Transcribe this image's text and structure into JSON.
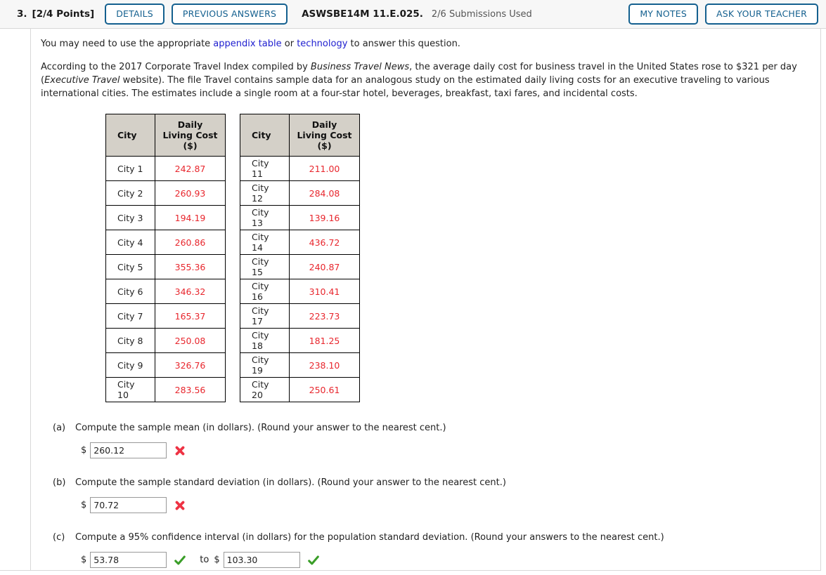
{
  "header": {
    "question_number": "3.",
    "points": "[2/4 Points]",
    "details_label": "DETAILS",
    "previous_answers_label": "PREVIOUS ANSWERS",
    "assignment_code": "ASWSBE14M 11.E.025.",
    "submissions": "2/6 Submissions Used",
    "my_notes_label": "MY NOTES",
    "ask_teacher_label": "ASK YOUR TEACHER",
    "accent_color": "#14608f",
    "bar_color": "#f7f7f7"
  },
  "intro": {
    "prefix": "You may need to use the appropriate ",
    "link1": "appendix table",
    "middle": " or ",
    "link2": "technology",
    "suffix": " to answer this question.",
    "link_color": "#2020d0"
  },
  "problem": {
    "s1": "According to the 2017 Corporate Travel Index compiled by ",
    "em1": "Business Travel News",
    "s2": ", the average daily cost for business travel in the United States rose to $321 per day (",
    "em2": "Executive Travel",
    "s3": " website). The file Travel contains sample data for an analogous study on the estimated daily living costs for an executive traveling to various international cities. The estimates include a single room at a four-star hotel, beverages, breakfast, taxi fares, and incidental costs."
  },
  "table": {
    "header_city": "City",
    "header_cost": "Daily Living Cost ($)",
    "header_bg": "#d4d0c8",
    "value_color": "#e8262d",
    "left_rows": [
      {
        "city": "City 1",
        "cost": "242.87"
      },
      {
        "city": "City 2",
        "cost": "260.93"
      },
      {
        "city": "City 3",
        "cost": "194.19"
      },
      {
        "city": "City 4",
        "cost": "260.86"
      },
      {
        "city": "City 5",
        "cost": "355.36"
      },
      {
        "city": "City 6",
        "cost": "346.32"
      },
      {
        "city": "City 7",
        "cost": "165.37"
      },
      {
        "city": "City 8",
        "cost": "250.08"
      },
      {
        "city": "City 9",
        "cost": "326.76"
      },
      {
        "city": "City 10",
        "cost": "283.56"
      }
    ],
    "right_rows": [
      {
        "city": "City 11",
        "cost": "211.00"
      },
      {
        "city": "City 12",
        "cost": "284.08"
      },
      {
        "city": "City 13",
        "cost": "139.16"
      },
      {
        "city": "City 14",
        "cost": "436.72"
      },
      {
        "city": "City 15",
        "cost": "240.87"
      },
      {
        "city": "City 16",
        "cost": "310.41"
      },
      {
        "city": "City 17",
        "cost": "223.73"
      },
      {
        "city": "City 18",
        "cost": "181.25"
      },
      {
        "city": "City 19",
        "cost": "238.10"
      },
      {
        "city": "City 20",
        "cost": "250.61"
      }
    ]
  },
  "parts": {
    "a": {
      "label": "(a)",
      "prompt": "Compute the sample mean (in dollars). (Round your answer to the nearest cent.)",
      "dollar": "$",
      "value": "260.12",
      "status": "incorrect"
    },
    "b": {
      "label": "(b)",
      "prompt": "Compute the sample standard deviation (in dollars). (Round your answer to the nearest cent.)",
      "dollar": "$",
      "value": "70.72",
      "status": "incorrect"
    },
    "c": {
      "label": "(c)",
      "prompt": "Compute a 95% confidence interval (in dollars) for the population standard deviation. (Round your answers to the nearest cent.)",
      "dollar_lower": "$",
      "value_lower": "53.78",
      "to_text": "to",
      "dollar_upper": "$",
      "value_upper": "103.30",
      "status_lower": "correct",
      "status_upper": "correct"
    }
  },
  "status_colors": {
    "incorrect": "#ee3344",
    "correct": "#3a9e28"
  }
}
